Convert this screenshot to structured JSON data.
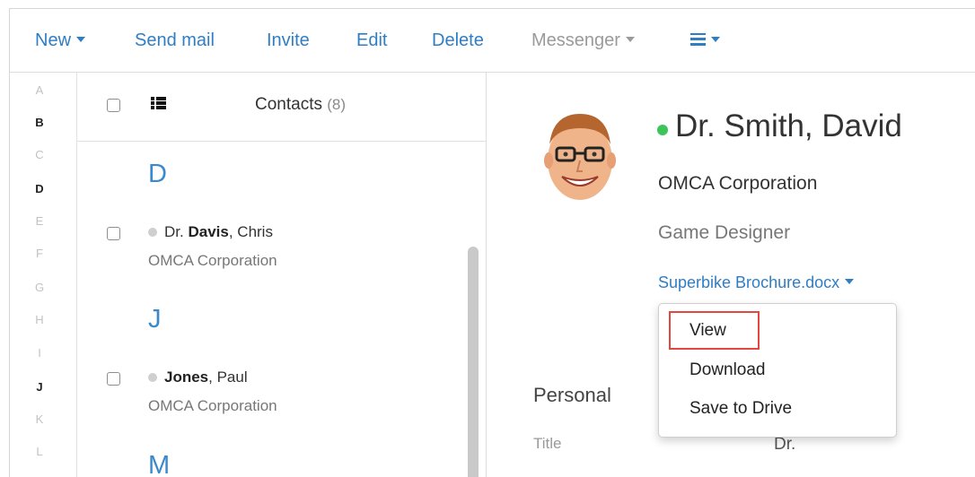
{
  "toolbar": {
    "new_label": "New",
    "send_mail_label": "Send mail",
    "invite_label": "Invite",
    "edit_label": "Edit",
    "delete_label": "Delete",
    "messenger_label": "Messenger",
    "accent_color": "#2f7ec4",
    "disabled_color": "#9a9a9a"
  },
  "alphabet": {
    "letters": [
      "A",
      "B",
      "C",
      "D",
      "E",
      "F",
      "G",
      "H",
      "I",
      "J",
      "K",
      "L"
    ],
    "active": [
      "B",
      "D",
      "J"
    ]
  },
  "list": {
    "title": "Contacts",
    "count": "(8)",
    "sections": [
      {
        "letter": "D",
        "contacts": [
          {
            "prefix": "Dr.",
            "last": "Davis",
            "first": ", Chris",
            "company": "OMCA Corporation"
          }
        ]
      },
      {
        "letter": "J",
        "contacts": [
          {
            "prefix": "",
            "last": "Jones",
            "first": ", Paul",
            "company": "OMCA Corporation"
          }
        ]
      },
      {
        "letter": "M",
        "contacts": []
      }
    ]
  },
  "detail": {
    "name": "Dr. Smith, David",
    "status_color": "#3cc45b",
    "company": "OMCA Corporation",
    "role": "Game Designer",
    "attachment": "Superbike Brochure.docx",
    "section_personal": "Personal",
    "fields": [
      {
        "label": "Title",
        "value": "Dr."
      }
    ]
  },
  "dropdown": {
    "items": [
      "View",
      "Download",
      "Save to Drive"
    ],
    "highlight_color": "#e2483c"
  }
}
